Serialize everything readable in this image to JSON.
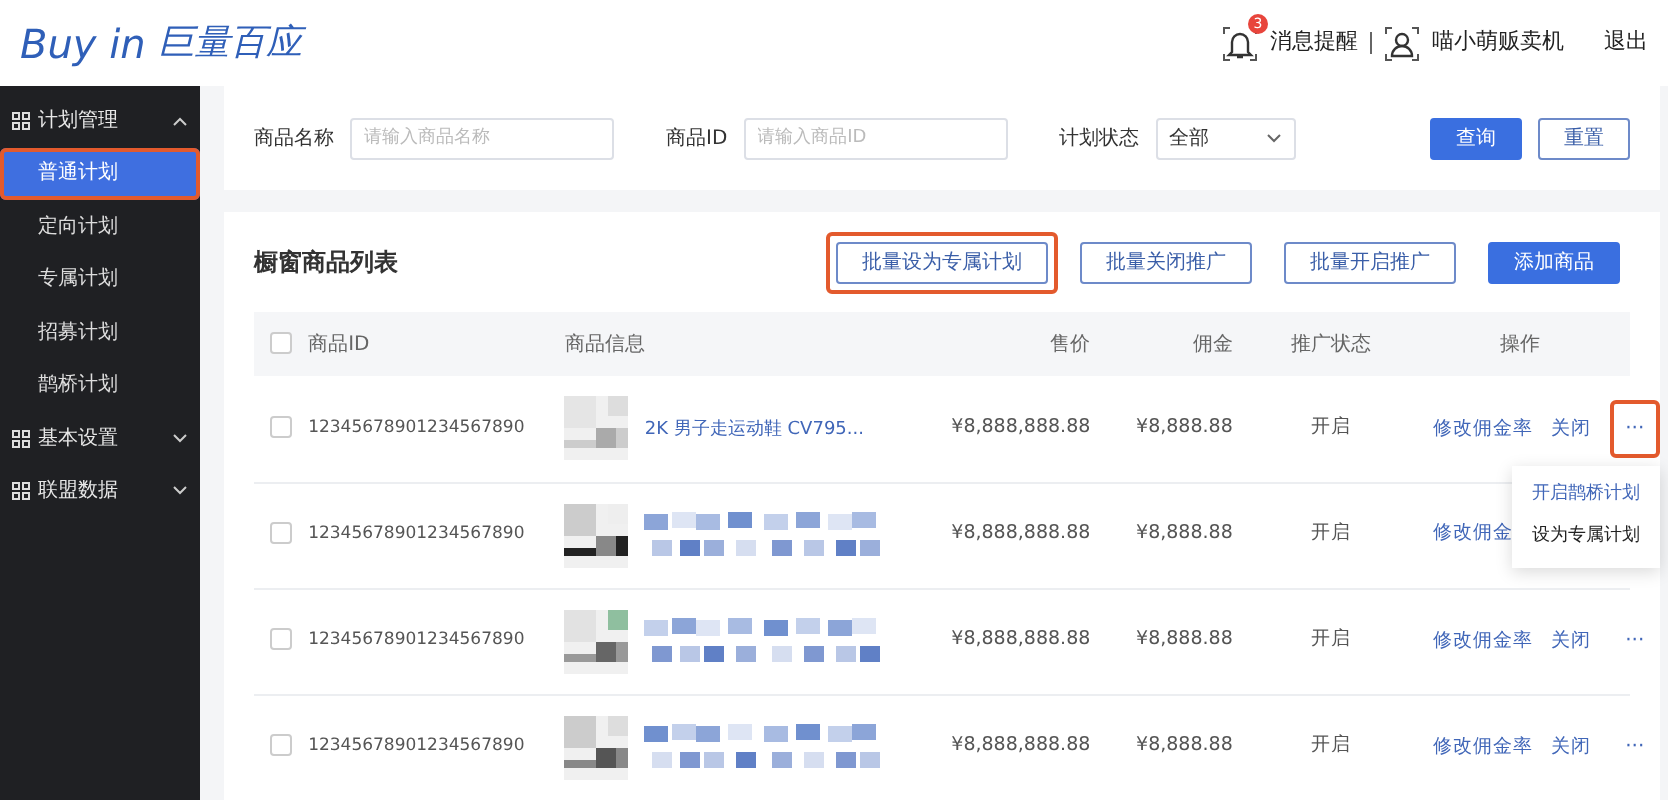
{
  "header": {
    "logo_latin": "Buy in",
    "logo_cjk": "巨量百应",
    "notifications": {
      "label": "消息提醒",
      "badge": "3"
    },
    "user": "喵小萌贩卖机",
    "logout": "退出"
  },
  "sidebar": {
    "items": [
      {
        "label": "计划管理",
        "expanded": true,
        "children": [
          {
            "label": "普通计划",
            "selected": true,
            "highlighted": true
          },
          {
            "label": "定向计划",
            "selected": false,
            "highlighted": false
          },
          {
            "label": "专属计划",
            "selected": false,
            "highlighted": false
          },
          {
            "label": "招募计划",
            "selected": false,
            "highlighted": false
          },
          {
            "label": "鹊桥计划",
            "selected": false,
            "highlighted": false
          }
        ]
      },
      {
        "label": "基本设置",
        "expanded": false
      },
      {
        "label": "联盟数据",
        "expanded": false
      }
    ]
  },
  "filters": {
    "fields": [
      {
        "label": "商品名称",
        "placeholder": "请输入商品名称"
      },
      {
        "label": "商品ID",
        "placeholder": "请输入商品ID"
      }
    ],
    "status": {
      "label": "计划状态",
      "value": "全部"
    },
    "buttons": [
      {
        "label": "查询",
        "primary": true
      },
      {
        "label": "重置",
        "primary": false
      }
    ]
  },
  "list": {
    "title": "橱窗商品列表",
    "actions": [
      {
        "label": "批量设为专属计划",
        "primary": false,
        "highlighted": true
      },
      {
        "label": "批量关闭推广",
        "primary": false,
        "highlighted": false
      },
      {
        "label": "批量开启推广",
        "primary": false,
        "highlighted": false
      },
      {
        "label": "添加商品",
        "primary": true,
        "highlighted": false
      }
    ],
    "header_checked": false,
    "columns": [
      "商品ID",
      "商品信息",
      "售价",
      "佣金",
      "推广状态",
      "操作"
    ],
    "rows": [
      {
        "checked": false,
        "id": "12345678901234567890",
        "title": "2K 男子走运动鞋 CV795...",
        "price": "¥8,888,888.88",
        "commission": "¥8,888.88",
        "status": "开启",
        "actions": [
          "修改佣金率",
          "关闭"
        ],
        "more": "···",
        "more_highlighted": true,
        "menu": {
          "items": [
            {
              "label": "开启鹊桥计划",
              "hovered": true
            },
            {
              "label": "设为专属计划",
              "hovered": false
            }
          ]
        }
      },
      {
        "checked": false,
        "id": "12345678901234567890",
        "price": "¥8,888,888.88",
        "commission": "¥8,888.88",
        "status": "开启",
        "actions": [
          "修改佣金"
        ]
      },
      {
        "checked": false,
        "id": "12345678901234567890",
        "price": "¥8,888,888.88",
        "commission": "¥8,888.88",
        "status": "开启",
        "actions": [
          "修改佣金率",
          "关闭"
        ],
        "more": "···",
        "more_highlighted": false
      },
      {
        "checked": false,
        "id": "12345678901234567890",
        "price": "¥8,888,888.88",
        "commission": "¥8,888.88",
        "status": "开启",
        "actions": [
          "修改佣金率",
          "关闭"
        ],
        "more": "···",
        "more_highlighted": false
      }
    ]
  }
}
